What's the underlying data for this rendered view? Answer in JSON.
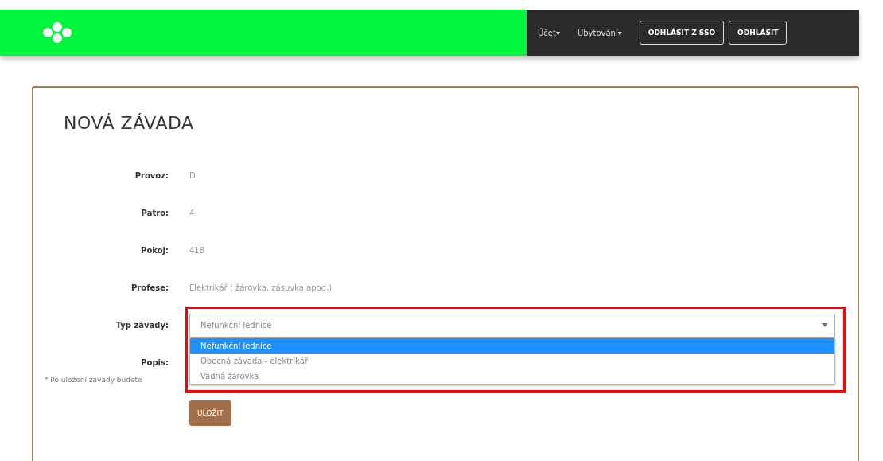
{
  "nav": {
    "menus": [
      {
        "label": "Účet",
        "caret": "▾"
      },
      {
        "label": "Ubytování",
        "caret": "▾"
      }
    ],
    "buttons": [
      "ODHLÁSIT Z SSO",
      "ODHLÁSIT"
    ]
  },
  "form": {
    "title": "NOVÁ ZÁVADA",
    "fields": [
      {
        "label": "Provoz:",
        "value": "D"
      },
      {
        "label": "Patro:",
        "value": "4"
      },
      {
        "label": "Pokoj:",
        "value": "418"
      },
      {
        "label": "Profese:",
        "value": "Elektrikář ( žárovka, zásuvka apod.)"
      }
    ],
    "type_field": {
      "label": "Typ závady:",
      "value": "Nefunkční lednice",
      "expanded": true,
      "options": [
        {
          "label": "Nefunkční lednice",
          "selected": true
        },
        {
          "label": "Obecná závada - elektrikář",
          "selected": false
        },
        {
          "label": "Vadná žárovka",
          "selected": false
        }
      ]
    },
    "description_label": "Popis:",
    "note": "* Po uložení závady budete",
    "save_button": "ULOŽIT"
  }
}
